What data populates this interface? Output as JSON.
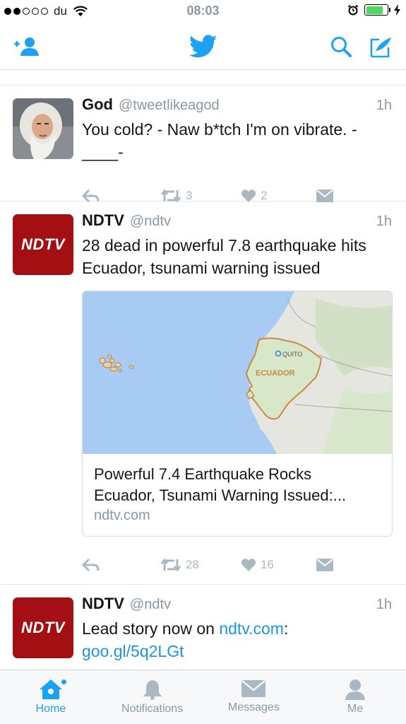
{
  "status_bar": {
    "carrier": "du",
    "time": "08:03"
  },
  "colors": {
    "accent": "#1da1f2",
    "ndtv_red": "#a30f12",
    "muted": "#8899a6",
    "battery": "#4cd964"
  },
  "navbar": {
    "icons": [
      "add-user-icon",
      "twitter-bird-icon",
      "search-icon",
      "compose-icon"
    ]
  },
  "tweets": [
    {
      "name": "God",
      "handle": "@tweetlikeagod",
      "time": "1h",
      "text": "You cold? - Naw b*tch I'm on vibrate. -____-",
      "retweets": "3",
      "likes": "2"
    },
    {
      "name": "NDTV",
      "avatar_text": "NDTV",
      "handle": "@ndtv",
      "time": "1h",
      "text": "28 dead in powerful 7.8 earthquake hits Ecuador, tsunami warning issued",
      "card": {
        "map_labels": {
          "city": "QUITO",
          "country": "ECUADOR"
        },
        "title_line1": "Powerful 7.4 Earthquake Rocks",
        "title_line2": "Ecuador, Tsunami Warning Issued:...",
        "domain": "ndtv.com"
      },
      "retweets": "28",
      "likes": "16"
    },
    {
      "name": "NDTV",
      "avatar_text": "NDTV",
      "handle": "@ndtv",
      "time": "1h",
      "text_plain": "Lead story now on ",
      "link1": "ndtv.com",
      "colon": ": ",
      "link2": "goo.gl/5q2LGt"
    }
  ],
  "tabbar": {
    "tabs": [
      {
        "label": "Home",
        "active": true
      },
      {
        "label": "Notifications",
        "active": false
      },
      {
        "label": "Messages",
        "active": false
      },
      {
        "label": "Me",
        "active": false
      }
    ]
  }
}
